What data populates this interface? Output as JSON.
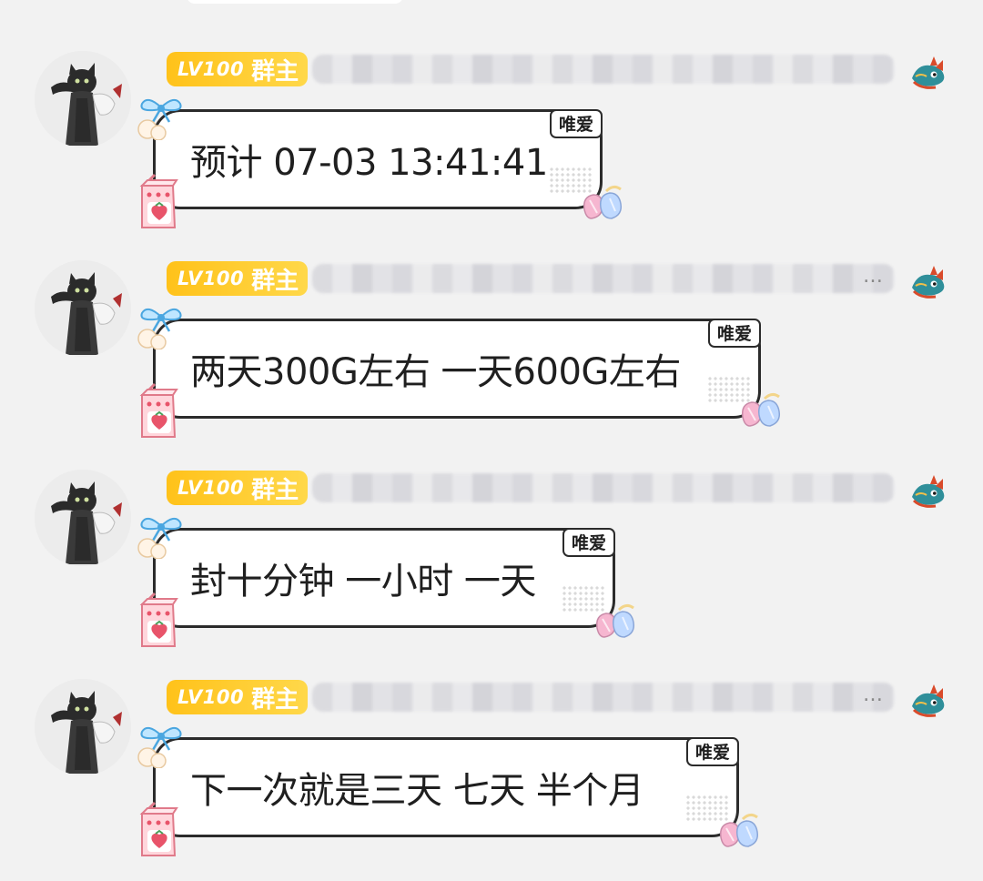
{
  "messages": [
    {
      "level": "LV100",
      "role": "群主",
      "has_ellipsis": false,
      "text": "预计 07-03 13:41:41",
      "tag": "唯爱"
    },
    {
      "level": "LV100",
      "role": "群主",
      "has_ellipsis": true,
      "ellipsis": "…",
      "text": "两天300G左右 一天600G左右",
      "tag": "唯爱"
    },
    {
      "level": "LV100",
      "role": "群主",
      "has_ellipsis": false,
      "text": "封十分钟 一小时 一天",
      "tag": "唯爱"
    },
    {
      "level": "LV100",
      "role": "群主",
      "has_ellipsis": true,
      "ellipsis": "…",
      "text": "下一次就是三天 七天 半个月",
      "tag": "唯爱"
    }
  ],
  "icons": {
    "avatar": "cat-avatar",
    "bubble_deco_top": "blue-bow-icon",
    "bubble_deco_bottom": "strawberry-juice-icon",
    "bubble_deco_right": "mitten-icon",
    "title_icon": "dragon-icon"
  },
  "colors": {
    "background": "#f2f2f2",
    "badge": "#ffc21a",
    "bubble_border": "#2b2b2b",
    "bubble_fill": "#ffffff"
  }
}
